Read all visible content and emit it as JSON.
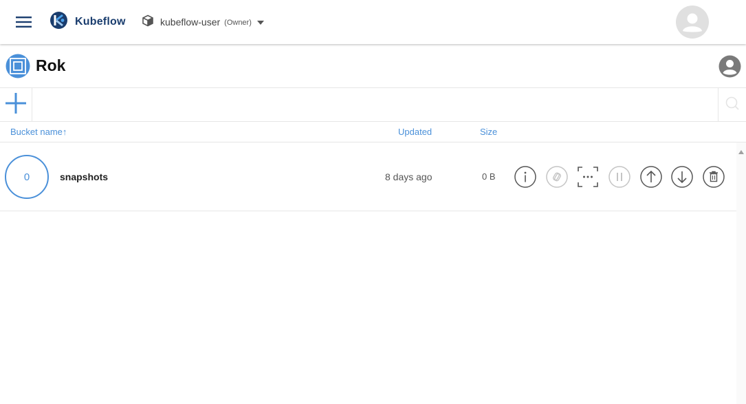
{
  "header": {
    "brand": "Kubeflow",
    "namespace": "kubeflow-user",
    "role": "(Owner)",
    "menu_icon": "hamburger-menu-icon",
    "namespace_icon": "cube-icon",
    "avatar_icon": "account-avatar-icon"
  },
  "app": {
    "title": "Rok",
    "logo_icon": "rok-logo-icon",
    "user_icon": "account-circle-icon"
  },
  "toolbar": {
    "add_icon": "plus-icon",
    "search_value": "",
    "search_placeholder": "",
    "search_icon": "search-icon"
  },
  "table": {
    "columns": {
      "name": "Bucket name↑",
      "updated": "Updated",
      "size": "Size"
    },
    "rows": [
      {
        "count": "0",
        "name": "snapshots",
        "updated": "8 days ago",
        "size": "0 B",
        "actions": [
          {
            "icon": "info-icon",
            "enabled": true
          },
          {
            "icon": "link-icon",
            "enabled": false
          },
          {
            "icon": "more-frame-icon",
            "enabled": true
          },
          {
            "icon": "pause-icon",
            "enabled": false
          },
          {
            "icon": "upload-arrow-icon",
            "enabled": true
          },
          {
            "icon": "download-arrow-icon",
            "enabled": true
          },
          {
            "icon": "trash-icon",
            "enabled": true
          }
        ]
      }
    ]
  },
  "colors": {
    "accent": "#4a90d9",
    "brand_text": "#1a3d6e",
    "icon_enabled": "#555555",
    "icon_disabled": "#c4c4c4",
    "divider": "#e6e6e6"
  }
}
